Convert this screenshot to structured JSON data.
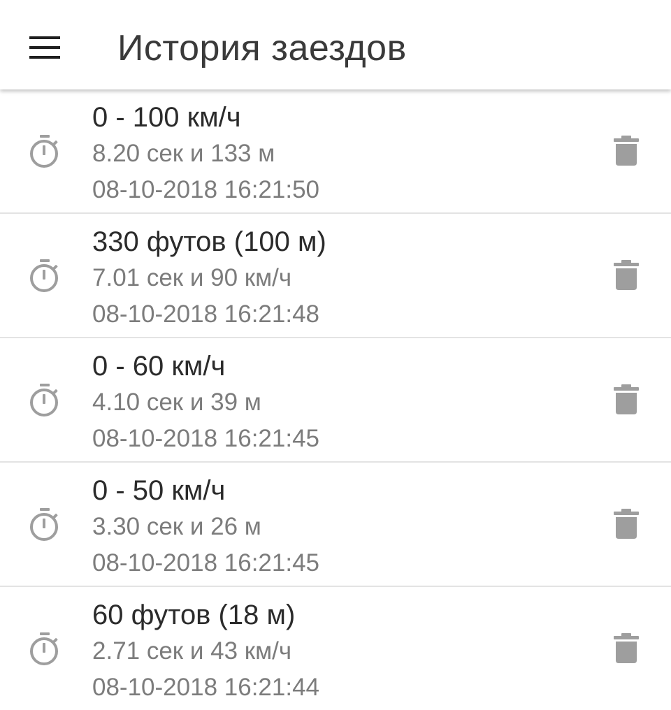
{
  "app_bar": {
    "menu_icon": "hamburger-menu-icon",
    "title": "История заездов"
  },
  "colors": {
    "title_text": "#3a3a3a",
    "primary_text": "#2b2b2b",
    "secondary_text": "#7c7c7c",
    "icon_gray": "#9e9e9e",
    "divider": "#e3e3e3"
  },
  "runs": [
    {
      "icon": "stopwatch-icon",
      "title": "0 - 100 км/ч",
      "detail": "8.20 сек и 133 м",
      "date": "08-10-2018 16:21:50",
      "action_icon": "trash-icon"
    },
    {
      "icon": "stopwatch-icon",
      "title": "330 футов (100 м)",
      "detail": "7.01 сек и 90 км/ч",
      "date": "08-10-2018 16:21:48",
      "action_icon": "trash-icon"
    },
    {
      "icon": "stopwatch-icon",
      "title": "0 - 60 км/ч",
      "detail": "4.10 сек и 39 м",
      "date": "08-10-2018 16:21:45",
      "action_icon": "trash-icon"
    },
    {
      "icon": "stopwatch-icon",
      "title": "0 - 50 км/ч",
      "detail": "3.30 сек и 26 м",
      "date": "08-10-2018 16:21:45",
      "action_icon": "trash-icon"
    },
    {
      "icon": "stopwatch-icon",
      "title": "60 футов (18 м)",
      "detail": "2.71 сек и 43 км/ч",
      "date": "08-10-2018 16:21:44",
      "action_icon": "trash-icon"
    }
  ]
}
